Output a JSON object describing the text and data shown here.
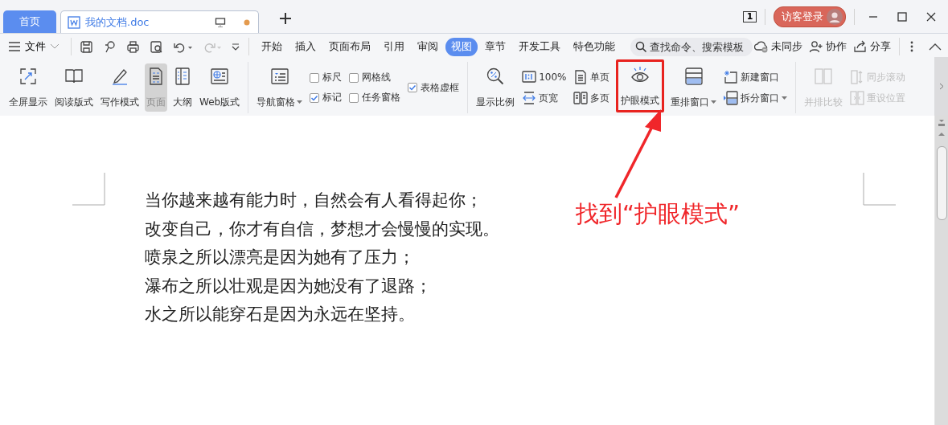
{
  "tabs": [
    {
      "label": "首页",
      "kind": "home",
      "selected": false
    },
    {
      "label": "我的文档.doc",
      "kind": "doc",
      "selected": true,
      "unsaved": true
    }
  ],
  "titlebar": {
    "window_count": "1",
    "login": "访客登录"
  },
  "menu": {
    "file": "文件",
    "tabs": [
      {
        "label": "开始",
        "selected": false
      },
      {
        "label": "插入",
        "selected": false
      },
      {
        "label": "页面布局",
        "selected": false
      },
      {
        "label": "引用",
        "selected": false
      },
      {
        "label": "审阅",
        "selected": false
      },
      {
        "label": "视图",
        "selected": true
      },
      {
        "label": "章节",
        "selected": false
      },
      {
        "label": "开发工具",
        "selected": false
      },
      {
        "label": "特色功能",
        "selected": false
      }
    ],
    "search": {
      "placeholder": "查找命令、搜索模板"
    },
    "actions": [
      "未同步",
      "协作",
      "分享"
    ]
  },
  "ribbon": {
    "groups": [
      {
        "disabled": false,
        "outlined": false,
        "columns": [
          [
            {
              "kind": "large",
              "label": "全屏显示",
              "selected": false,
              "dropdown": false
            }
          ],
          [
            {
              "kind": "large",
              "label": "阅读版式",
              "selected": false,
              "dropdown": false
            }
          ],
          [
            {
              "kind": "large",
              "label": "写作模式",
              "selected": false,
              "dropdown": false
            }
          ],
          [
            {
              "kind": "large",
              "label": "页面",
              "selected": true,
              "dropdown": false
            }
          ],
          [
            {
              "kind": "large",
              "label": "大纲",
              "selected": false,
              "dropdown": false
            }
          ],
          [
            {
              "kind": "large",
              "label": "Web版式",
              "selected": false,
              "dropdown": false
            }
          ]
        ]
      },
      {
        "disabled": false,
        "outlined": false,
        "columns": [
          [
            {
              "kind": "large",
              "label": "导航窗格",
              "selected": false,
              "dropdown": true
            }
          ],
          [
            {
              "kind": "check",
              "label": "标尺",
              "checked": false
            },
            {
              "kind": "check",
              "label": "标记",
              "checked": true
            }
          ],
          [
            {
              "kind": "check",
              "label": "网格线",
              "checked": false
            },
            {
              "kind": "check",
              "label": "任务窗格",
              "checked": false
            }
          ],
          [
            {
              "kind": "check",
              "label": "表格虚框",
              "checked": true
            }
          ]
        ]
      },
      {
        "disabled": false,
        "outlined": false,
        "columns": [
          [
            {
              "kind": "large",
              "label": "显示比例",
              "selected": false,
              "dropdown": false
            }
          ],
          [
            {
              "kind": "small",
              "label": "100%",
              "selected": false,
              "dropdown": false
            },
            {
              "kind": "small",
              "label": "页宽",
              "selected": false,
              "dropdown": false
            }
          ],
          [
            {
              "kind": "small",
              "label": "单页",
              "selected": false,
              "dropdown": false
            },
            {
              "kind": "small",
              "label": "多页",
              "selected": false,
              "dropdown": false
            }
          ]
        ]
      },
      {
        "disabled": false,
        "outlined": true,
        "columns": [
          [
            {
              "kind": "large",
              "label": "护眼模式",
              "selected": false,
              "dropdown": false
            }
          ]
        ]
      },
      {
        "disabled": false,
        "outlined": false,
        "columns": [
          [
            {
              "kind": "large",
              "label": "重排窗口",
              "selected": false,
              "dropdown": true
            }
          ],
          [
            {
              "kind": "small",
              "label": "新建窗口",
              "selected": false,
              "dropdown": false
            },
            {
              "kind": "small",
              "label": "拆分窗口",
              "selected": false,
              "dropdown": true
            }
          ]
        ]
      },
      {
        "disabled": true,
        "outlined": false,
        "columns": [
          [
            {
              "kind": "large",
              "label": "并排比较",
              "selected": false,
              "dropdown": false
            }
          ],
          [
            {
              "kind": "small",
              "label": "同步滚动",
              "selected": false,
              "dropdown": false
            },
            {
              "kind": "small",
              "label": "重设位置",
              "selected": false,
              "dropdown": false
            }
          ]
        ]
      }
    ]
  },
  "document": {
    "lines": [
      "当你越来越有能力时，自然会有人看得起你；",
      "改变自己，你才有自信，梦想才会慢慢的实现。",
      "喷泉之所以漂亮是因为她有了压力；",
      "瀑布之所以壮观是因为她没有了退路；",
      "水之所以能穿石是因为永远在坚持。"
    ]
  },
  "annotation": {
    "text": "找到“护眼模式”"
  }
}
